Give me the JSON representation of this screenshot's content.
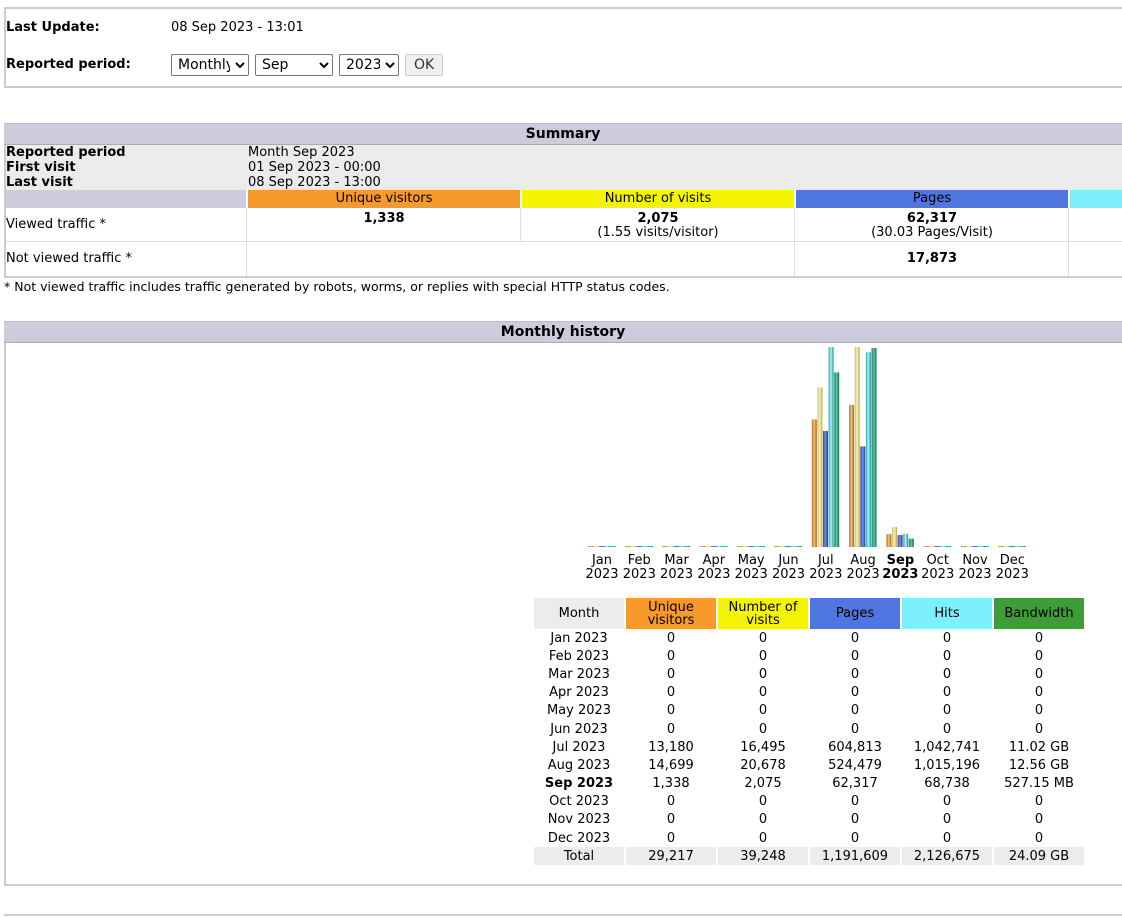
{
  "header": {
    "last_update_label": "Last Update:",
    "last_update_value": "08 Sep 2023 - 13:01",
    "period_label": "Reported period:",
    "period_type": "Monthly",
    "period_month": "Sep",
    "period_year": "2023",
    "ok_label": "OK"
  },
  "summary": {
    "title": "Summary",
    "reported_period_label": "Reported period",
    "reported_period_value": "Month Sep 2023",
    "first_visit_label": "First visit",
    "first_visit_value": "01 Sep 2023 - 00:00",
    "last_visit_label": "Last visit",
    "last_visit_value": "08 Sep 2023 - 13:00",
    "col_unique": "Unique visitors",
    "col_visits": "Number of visits",
    "col_pages": "Pages",
    "viewed_label": "Viewed traffic *",
    "viewed_unique": "1,338",
    "viewed_visits": "2,075",
    "viewed_visits_sub": "(1.55 visits/visitor)",
    "viewed_pages": "62,317",
    "viewed_pages_sub": "(30.03 Pages/Visit)",
    "not_viewed_label": "Not viewed traffic *",
    "not_viewed_pages": "17,873",
    "footnote": "* Not viewed traffic includes traffic generated by robots, worms, or replies with special HTTP status codes."
  },
  "history": {
    "title": "Monthly history",
    "columns": {
      "month": "Month",
      "unique_1": "Unique",
      "unique_2": "visitors",
      "visits_1": "Number of",
      "visits_2": "visits",
      "pages": "Pages",
      "hits": "Hits",
      "bandwidth": "Bandwidth"
    },
    "rows": [
      {
        "month": "Jan 2023",
        "unique": "0",
        "visits": "0",
        "pages": "0",
        "hits": "0",
        "bandwidth": "0"
      },
      {
        "month": "Feb 2023",
        "unique": "0",
        "visits": "0",
        "pages": "0",
        "hits": "0",
        "bandwidth": "0"
      },
      {
        "month": "Mar 2023",
        "unique": "0",
        "visits": "0",
        "pages": "0",
        "hits": "0",
        "bandwidth": "0"
      },
      {
        "month": "Apr 2023",
        "unique": "0",
        "visits": "0",
        "pages": "0",
        "hits": "0",
        "bandwidth": "0"
      },
      {
        "month": "May 2023",
        "unique": "0",
        "visits": "0",
        "pages": "0",
        "hits": "0",
        "bandwidth": "0"
      },
      {
        "month": "Jun 2023",
        "unique": "0",
        "visits": "0",
        "pages": "0",
        "hits": "0",
        "bandwidth": "0"
      },
      {
        "month": "Jul 2023",
        "unique": "13,180",
        "visits": "16,495",
        "pages": "604,813",
        "hits": "1,042,741",
        "bandwidth": "11.02 GB"
      },
      {
        "month": "Aug 2023",
        "unique": "14,699",
        "visits": "20,678",
        "pages": "524,479",
        "hits": "1,015,196",
        "bandwidth": "12.56 GB"
      },
      {
        "month": "Sep 2023",
        "unique": "1,338",
        "visits": "2,075",
        "pages": "62,317",
        "hits": "68,738",
        "bandwidth": "527.15 MB"
      },
      {
        "month": "Oct 2023",
        "unique": "0",
        "visits": "0",
        "pages": "0",
        "hits": "0",
        "bandwidth": "0"
      },
      {
        "month": "Nov 2023",
        "unique": "0",
        "visits": "0",
        "pages": "0",
        "hits": "0",
        "bandwidth": "0"
      },
      {
        "month": "Dec 2023",
        "unique": "0",
        "visits": "0",
        "pages": "0",
        "hits": "0",
        "bandwidth": "0"
      }
    ],
    "total": {
      "month": "Total",
      "unique": "29,217",
      "visits": "39,248",
      "pages": "1,191,609",
      "hits": "2,126,675",
      "bandwidth": "24.09 GB"
    }
  },
  "colors": {
    "unique": "#f7992b",
    "visits": "#f4f400",
    "pages": "#4f75e0",
    "hits": "#7df0ff",
    "bandwidth": "#3f9c38",
    "title_bar": "#ccccdd"
  },
  "chart_data": {
    "type": "bar",
    "categories": [
      "Jan",
      "Feb",
      "Mar",
      "Apr",
      "May",
      "Jun",
      "Jul",
      "Aug",
      "Sep",
      "Oct",
      "Nov",
      "Dec"
    ],
    "year_labels": [
      "2023",
      "2023",
      "2023",
      "2023",
      "2023",
      "2023",
      "2023",
      "2023",
      "2023",
      "2023",
      "2023",
      "2023"
    ],
    "current_index": 8,
    "series": [
      {
        "name": "Unique visitors",
        "values": [
          0,
          0,
          0,
          0,
          0,
          0,
          13180,
          14699,
          1338,
          0,
          0,
          0
        ]
      },
      {
        "name": "Number of visits",
        "values": [
          0,
          0,
          0,
          0,
          0,
          0,
          16495,
          20678,
          2075,
          0,
          0,
          0
        ]
      },
      {
        "name": "Pages",
        "values": [
          0,
          0,
          0,
          0,
          0,
          0,
          604813,
          524479,
          62317,
          0,
          0,
          0
        ]
      },
      {
        "name": "Hits",
        "values": [
          0,
          0,
          0,
          0,
          0,
          0,
          1042741,
          1015196,
          68738,
          0,
          0,
          0
        ]
      },
      {
        "name": "Bandwidth",
        "values": [
          0,
          0,
          0,
          0,
          0,
          0,
          11.02,
          12.56,
          0.527,
          0,
          0,
          0
        ]
      }
    ],
    "grid": false,
    "legend": "none"
  }
}
